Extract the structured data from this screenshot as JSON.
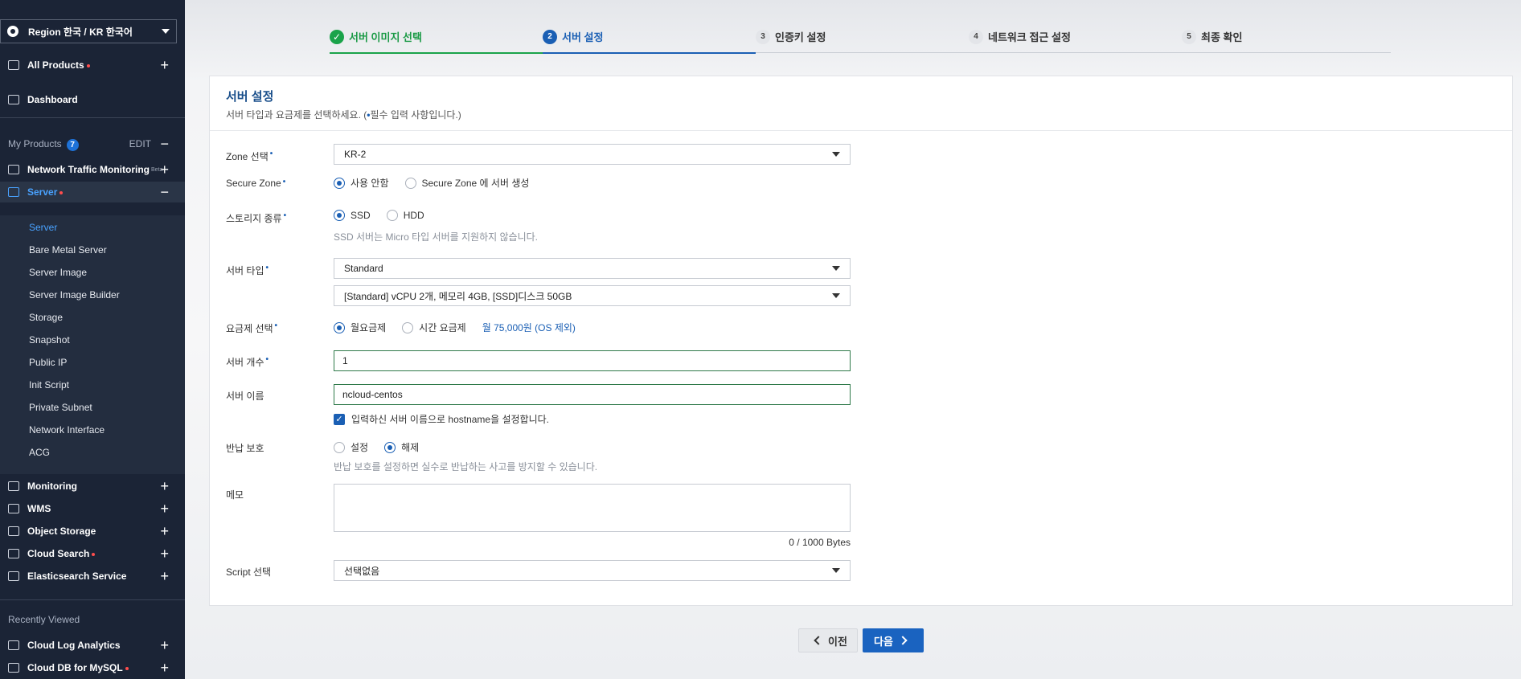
{
  "sidebar": {
    "region": "Region 한국 / KR 한국어",
    "all_products": "All Products",
    "dashboard": "Dashboard",
    "my_products": "My Products",
    "my_products_count": "7",
    "edit": "EDIT",
    "network_traffic": "Network Traffic Monitoring",
    "network_traffic_badge": "Beta",
    "server": "Server",
    "server_items": [
      "Server",
      "Bare Metal Server",
      "Server Image",
      "Server Image Builder",
      "Storage",
      "Snapshot",
      "Public IP",
      "Init Script",
      "Private Subnet",
      "Network Interface",
      "ACG"
    ],
    "monitoring": "Monitoring",
    "wms": "WMS",
    "object_storage": "Object Storage",
    "cloud_search": "Cloud Search",
    "elasticsearch": "Elasticsearch Service",
    "recently_viewed": "Recently Viewed",
    "cloud_log": "Cloud Log Analytics",
    "cloud_db": "Cloud DB for MySQL"
  },
  "steps": [
    {
      "num": "✓",
      "label": "서버 이미지 선택",
      "state": "done"
    },
    {
      "num": "2",
      "label": "서버 설정",
      "state": "current"
    },
    {
      "num": "3",
      "label": "인증키 설정",
      "state": "pending"
    },
    {
      "num": "4",
      "label": "네트워크 접근 설정",
      "state": "pending"
    },
    {
      "num": "5",
      "label": "최종 확인",
      "state": "pending"
    }
  ],
  "form": {
    "title": "서버 설정",
    "desc_pre": "서버 타입과 요금제를 선택하세요. (",
    "desc_req": "•",
    "desc_post": "필수 입력 사항입니다.)",
    "zone_label": "Zone 선택",
    "zone_value": "KR-2",
    "secure_zone_label": "Secure Zone",
    "secure_zone_opt1": "사용 안함",
    "secure_zone_opt2": "Secure Zone 에 서버 생성",
    "storage_label": "스토리지 종류",
    "storage_opt1": "SSD",
    "storage_opt2": "HDD",
    "storage_hint": "SSD 서버는 Micro 타입 서버를 지원하지 않습니다.",
    "server_type_label": "서버 타입",
    "server_type_value": "Standard",
    "server_spec_value": "[Standard] vCPU 2개, 메모리 4GB, [SSD]디스크 50GB",
    "plan_label": "요금제 선택",
    "plan_opt1": "월요금제",
    "plan_opt2": "시간 요금제",
    "plan_price": "월 75,000원 (OS 제외)",
    "count_label": "서버 개수",
    "count_value": "1",
    "name_label": "서버 이름",
    "name_value": "ncloud-centos",
    "hostname_check": "입력하신 서버 이름으로 hostname을 설정합니다.",
    "return_label": "반납 보호",
    "return_opt1": "설정",
    "return_opt2": "해제",
    "return_hint": "반납 보호를 설정하면 실수로 반납하는 사고를 방지할 수 있습니다.",
    "memo_label": "메모",
    "memo_counter": "0 / 1000 Bytes",
    "script_label": "Script 선택",
    "script_value": "선택없음",
    "required_mark": "•"
  },
  "buttons": {
    "prev": "이전",
    "next": "다음"
  },
  "colors": {
    "sidebar_bg": "#1b2436",
    "accent": "#1a5fb4",
    "done": "#1aa34a",
    "required_dot": "#ff4d4d"
  }
}
